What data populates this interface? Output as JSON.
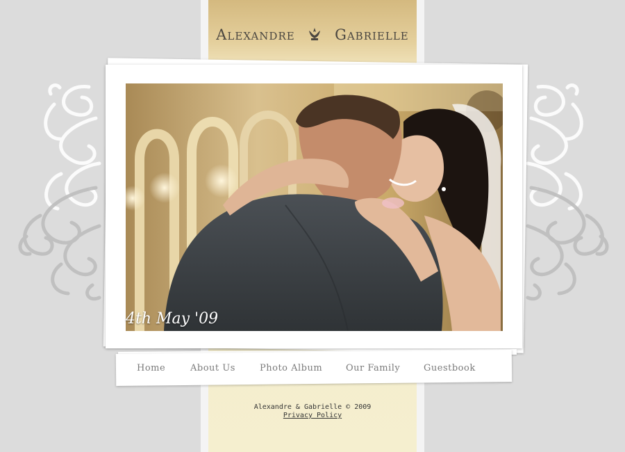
{
  "header": {
    "name_left": "Alexandre",
    "name_right": "Gabrielle",
    "emblem_icon": "crown-icon"
  },
  "hero": {
    "caption": "4th May '09",
    "photo_subject": "wedding couple embracing"
  },
  "nav": {
    "items": [
      {
        "label": "Home"
      },
      {
        "label": "About Us"
      },
      {
        "label": "Photo Album"
      },
      {
        "label": "Our Family"
      },
      {
        "label": "Guestbook"
      }
    ]
  },
  "footer": {
    "copyright": "Alexandre & Gabrielle © 2009",
    "privacy_link": "Privacy Policy"
  },
  "colors": {
    "background": "#dcdcdc",
    "column_gold": "#d4b97f",
    "column_cream": "#f5efcf",
    "title_text": "#4a4640",
    "nav_text": "#7a7a7a"
  }
}
